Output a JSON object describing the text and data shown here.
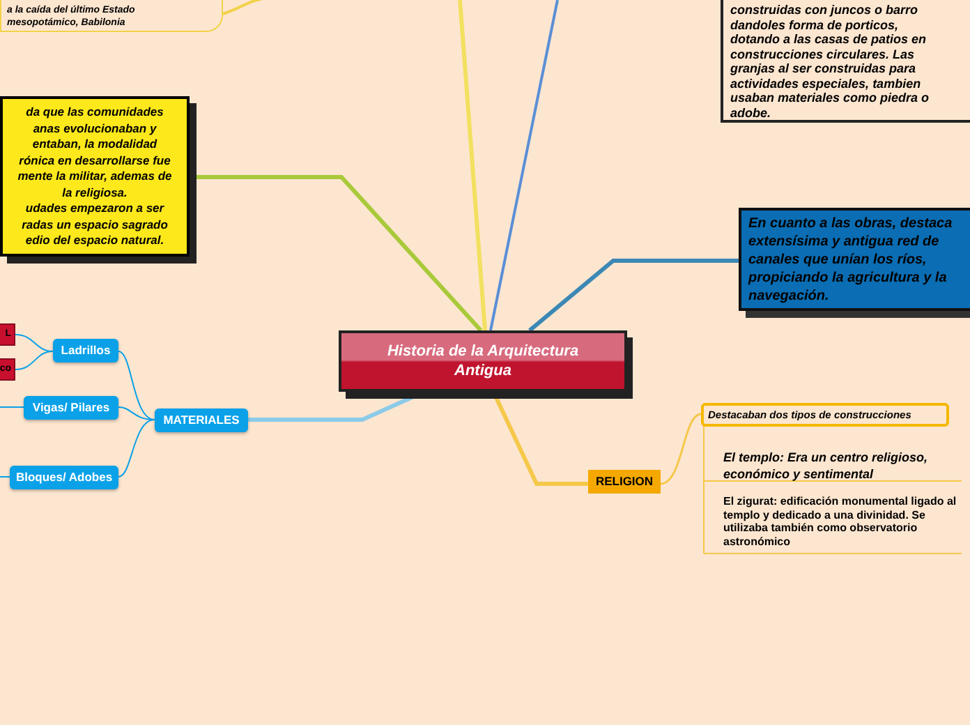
{
  "central_topic": {
    "title": "Historia de la Arquitectura Antigua"
  },
  "notes": [
    {
      "kind": "plain",
      "text": "a la caída del último Estado\nmesopotámico, Babilonia"
    },
    {
      "kind": "yellow",
      "text": "da que las comunidades\nanas evolucionaban y\nentaban, la modalidad\nrónica en desarrollarse fue\nmente la militar, ademas de\nla religiosa.\nudades empezaron a ser\nradas un espacio sagrado\nedio del espacio natural."
    },
    {
      "kind": "outlined",
      "text": "construidas con juncos o barro\ndandoles forma de porticos,\ndotando a las casas de patios en\nconstrucciones circulares. Las\ngranjas al ser construidas para\nactividades especiales, tambien\nusaban materiales como piedra o\nadobe."
    },
    {
      "kind": "blue",
      "text": "En cuanto a las obras, destaca\nextensísima y antigua red de\ncanales que unían los ríos,\npropiciando la agricultura y la\nnavegación."
    }
  ],
  "materiales": {
    "label": "MATERIALES",
    "children": [
      {
        "label": "Ladrillos",
        "children": [
          {
            "label": "L"
          },
          {
            "label": "co"
          }
        ]
      },
      {
        "label": "Vigas/ Pilares"
      },
      {
        "label": "Bloques/ Adobes"
      }
    ]
  },
  "religion": {
    "label": "RELIGION",
    "heading": "Destacaban dos tipos de construcciones",
    "items": [
      {
        "kind": "italic",
        "text": "El templo: Era un centro religioso, económico y sentimental"
      },
      {
        "kind": "plain",
        "text": "El zigurat: edificación monumental ligado al templo y dedicado a una divinidad. Se utilizaba también como observatorio astronómico"
      }
    ]
  }
}
